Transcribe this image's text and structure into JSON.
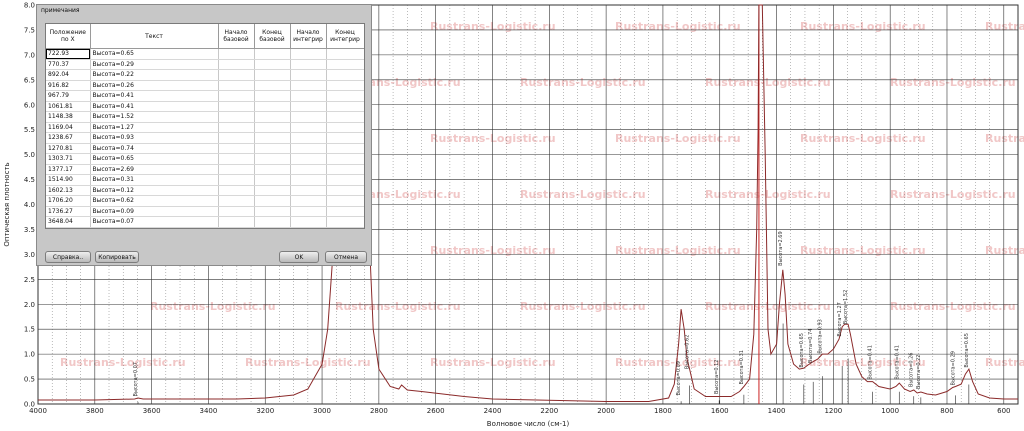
{
  "dialog": {
    "title": "примечания",
    "columns": [
      "Положение по X",
      "Текст",
      "Начало базовой",
      "Конец базовой",
      "Начало интегрир",
      "Конец интегрир"
    ],
    "rows": [
      {
        "pos": "722.93",
        "text": "Высота=0.65"
      },
      {
        "pos": "770.37",
        "text": "Высота=0.29"
      },
      {
        "pos": "892.04",
        "text": "Высота=0.22"
      },
      {
        "pos": "916.82",
        "text": "Высота=0.26"
      },
      {
        "pos": "967.79",
        "text": "Высота=0.41"
      },
      {
        "pos": "1061.81",
        "text": "Высота=0.41"
      },
      {
        "pos": "1148.38",
        "text": "Высота=1.52"
      },
      {
        "pos": "1169.04",
        "text": "Высота=1.27"
      },
      {
        "pos": "1238.67",
        "text": "Высота=0.93"
      },
      {
        "pos": "1270.81",
        "text": "Высота=0.74"
      },
      {
        "pos": "1303.71",
        "text": "Высота=0.65"
      },
      {
        "pos": "1377.17",
        "text": "Высота=2.69"
      },
      {
        "pos": "1514.90",
        "text": "Высота=0.31"
      },
      {
        "pos": "1602.13",
        "text": "Высота=0.12"
      },
      {
        "pos": "1706.20",
        "text": "Высота=0.62"
      },
      {
        "pos": "1736.27",
        "text": "Высота=0.09"
      },
      {
        "pos": "3648.04",
        "text": "Высота=0.07"
      }
    ],
    "buttons": {
      "help": "Справка..",
      "copy": "Копировать",
      "ok": "OK",
      "cancel": "Отмена"
    }
  },
  "watermark": "Rustrans-Logistic.ru",
  "chart_data": {
    "type": "line",
    "xlabel": "Волновое число (см-1)",
    "ylabel": "Оптическая плотность",
    "xlim": [
      4000,
      550
    ],
    "ylim": [
      0,
      8
    ],
    "x_ticks": [
      "4000",
      "3800",
      "3600",
      "3400",
      "3200",
      "3000",
      "2800",
      "2600",
      "2400",
      "2200",
      "2000",
      "1800",
      "1600",
      "1400",
      "1200",
      "1000",
      "800",
      "600"
    ],
    "y_ticks": [
      "0.0",
      "0.5",
      "1.0",
      "1.5",
      "2.0",
      "2.5",
      "3.0",
      "3.5",
      "4.0",
      "4.5",
      "5.0",
      "5.5",
      "6.0",
      "6.5",
      "7.0",
      "7.5",
      "8.0"
    ],
    "grid": true,
    "line_color": "#8b2a2a",
    "marker_color": "#cc2222",
    "markers": [
      1462
    ],
    "peak_labels": [
      {
        "x": 3648,
        "y": 0.07,
        "label": "Высота=0.07"
      },
      {
        "x": 1736,
        "y": 0.09,
        "label": "Высота=0.09"
      },
      {
        "x": 1706,
        "y": 0.62,
        "label": "Высота=0.62"
      },
      {
        "x": 1602,
        "y": 0.12,
        "label": "Высота=0.12"
      },
      {
        "x": 1515,
        "y": 0.31,
        "label": "Высота=0.31"
      },
      {
        "x": 1377,
        "y": 2.69,
        "label": "Высота=2.69"
      },
      {
        "x": 1304,
        "y": 0.65,
        "label": "Высота=0.65"
      },
      {
        "x": 1271,
        "y": 0.74,
        "label": "Высота=0.74"
      },
      {
        "x": 1239,
        "y": 0.93,
        "label": "Высота=0.93"
      },
      {
        "x": 1169,
        "y": 1.27,
        "label": "Высота=1.27"
      },
      {
        "x": 1148,
        "y": 1.52,
        "label": "Высота=1.52"
      },
      {
        "x": 1062,
        "y": 0.41,
        "label": "Высота=0.41"
      },
      {
        "x": 968,
        "y": 0.41,
        "label": "Высота=0.41"
      },
      {
        "x": 917,
        "y": 0.26,
        "label": "Высота=0.26"
      },
      {
        "x": 892,
        "y": 0.22,
        "label": "Высота=0.22"
      },
      {
        "x": 770,
        "y": 0.29,
        "label": "Высота=0.29"
      },
      {
        "x": 723,
        "y": 0.65,
        "label": "Высота=0.65"
      }
    ],
    "spectrum": [
      [
        4000,
        0.08
      ],
      [
        3800,
        0.08
      ],
      [
        3660,
        0.1
      ],
      [
        3648,
        0.12
      ],
      [
        3630,
        0.1
      ],
      [
        3400,
        0.1
      ],
      [
        3300,
        0.1
      ],
      [
        3200,
        0.12
      ],
      [
        3100,
        0.18
      ],
      [
        3050,
        0.3
      ],
      [
        3000,
        0.8
      ],
      [
        2980,
        1.5
      ],
      [
        2962,
        3.0
      ],
      [
        2950,
        5.0
      ],
      [
        2935,
        7.5
      ],
      [
        2925,
        8.0
      ],
      [
        2860,
        8.0
      ],
      [
        2850,
        7.0
      ],
      [
        2835,
        3.5
      ],
      [
        2820,
        1.5
      ],
      [
        2800,
        0.7
      ],
      [
        2760,
        0.35
      ],
      [
        2730,
        0.3
      ],
      [
        2720,
        0.38
      ],
      [
        2700,
        0.28
      ],
      [
        2650,
        0.25
      ],
      [
        2500,
        0.15
      ],
      [
        2400,
        0.1
      ],
      [
        2000,
        0.05
      ],
      [
        1850,
        0.05
      ],
      [
        1780,
        0.12
      ],
      [
        1760,
        0.4
      ],
      [
        1745,
        1.2
      ],
      [
        1736,
        1.9
      ],
      [
        1725,
        1.5
      ],
      [
        1715,
        0.9
      ],
      [
        1706,
        0.7
      ],
      [
        1690,
        0.3
      ],
      [
        1650,
        0.15
      ],
      [
        1602,
        0.15
      ],
      [
        1560,
        0.15
      ],
      [
        1530,
        0.25
      ],
      [
        1515,
        0.35
      ],
      [
        1495,
        0.5
      ],
      [
        1480,
        1.4
      ],
      [
        1470,
        3.5
      ],
      [
        1465,
        5.5
      ],
      [
        1462,
        8.0
      ],
      [
        1450,
        8.0
      ],
      [
        1440,
        5.0
      ],
      [
        1430,
        1.5
      ],
      [
        1420,
        1.0
      ],
      [
        1400,
        1.2
      ],
      [
        1390,
        2.0
      ],
      [
        1378,
        2.69
      ],
      [
        1370,
        2.2
      ],
      [
        1360,
        1.2
      ],
      [
        1340,
        0.8
      ],
      [
        1320,
        0.7
      ],
      [
        1304,
        0.72
      ],
      [
        1290,
        0.78
      ],
      [
        1271,
        0.85
      ],
      [
        1255,
        0.9
      ],
      [
        1239,
        1.0
      ],
      [
        1220,
        1.0
      ],
      [
        1200,
        1.1
      ],
      [
        1180,
        1.3
      ],
      [
        1169,
        1.55
      ],
      [
        1160,
        1.6
      ],
      [
        1148,
        1.6
      ],
      [
        1140,
        1.4
      ],
      [
        1120,
        0.8
      ],
      [
        1100,
        0.55
      ],
      [
        1080,
        0.45
      ],
      [
        1062,
        0.45
      ],
      [
        1040,
        0.35
      ],
      [
        1000,
        0.3
      ],
      [
        980,
        0.35
      ],
      [
        968,
        0.42
      ],
      [
        950,
        0.3
      ],
      [
        930,
        0.25
      ],
      [
        917,
        0.28
      ],
      [
        905,
        0.22
      ],
      [
        892,
        0.24
      ],
      [
        870,
        0.2
      ],
      [
        840,
        0.18
      ],
      [
        800,
        0.25
      ],
      [
        780,
        0.33
      ],
      [
        770,
        0.35
      ],
      [
        750,
        0.4
      ],
      [
        735,
        0.6
      ],
      [
        723,
        0.7
      ],
      [
        710,
        0.45
      ],
      [
        690,
        0.2
      ],
      [
        650,
        0.12
      ],
      [
        600,
        0.1
      ],
      [
        550,
        0.1
      ]
    ]
  }
}
